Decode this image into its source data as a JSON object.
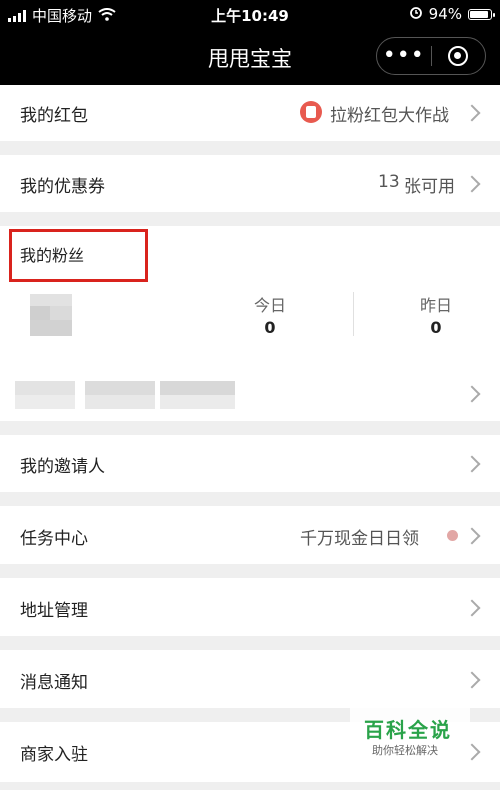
{
  "status": {
    "carrier": "中国移动",
    "time": "上午10:49",
    "battery": "94%",
    "battery_level": 0.94
  },
  "nav": {
    "title": "甩甩宝宝",
    "more_icon": "more-dots-icon",
    "close_icon": "target-ring-icon"
  },
  "rows": {
    "redpack": {
      "label": "我的红包",
      "extra": "拉粉红包大作战"
    },
    "coupon": {
      "label": "我的优惠券",
      "count": "13",
      "suffix": "张可用"
    },
    "fans": {
      "label": "我的粉丝",
      "today_label": "今日",
      "today_value": "0",
      "yesterday_label": "昨日",
      "yesterday_value": "0"
    },
    "inviter": {
      "label": "我的邀请人"
    },
    "tasks": {
      "label": "任务中心",
      "extra": "千万现金日日领"
    },
    "address": {
      "label": "地址管理"
    },
    "notify": {
      "label": "消息通知"
    },
    "merchant": {
      "label": "商家入驻"
    }
  },
  "watermark": {
    "title": "百科全说",
    "subtitle": "助你轻松解决"
  },
  "colors": {
    "highlight": "#d9231d",
    "redpack": "#e85a4f",
    "watermark": "#2aa34a"
  }
}
